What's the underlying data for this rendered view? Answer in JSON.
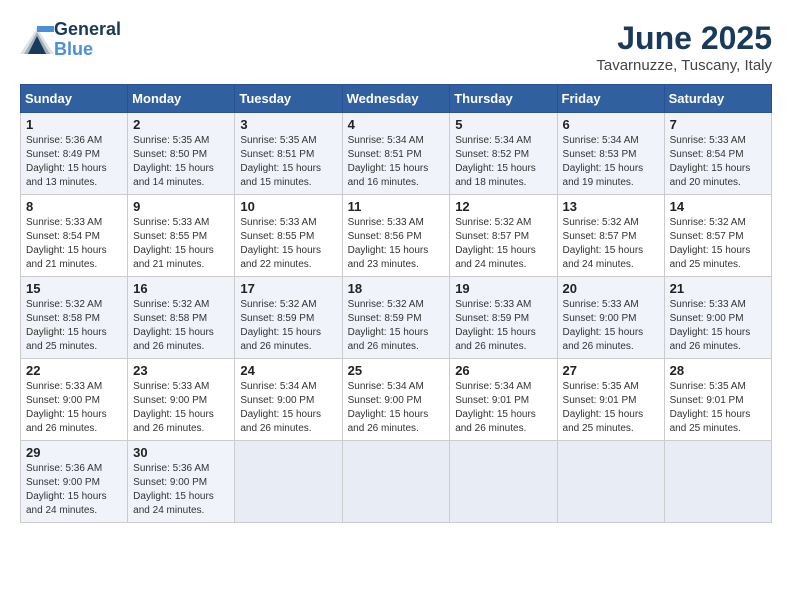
{
  "logo": {
    "line1": "General",
    "line2": "Blue"
  },
  "title": "June 2025",
  "location": "Tavarnuzze, Tuscany, Italy",
  "weekdays": [
    "Sunday",
    "Monday",
    "Tuesday",
    "Wednesday",
    "Thursday",
    "Friday",
    "Saturday"
  ],
  "weeks": [
    [
      {
        "day": 1,
        "sunrise": "5:36 AM",
        "sunset": "8:49 PM",
        "daylight": "15 hours and 13 minutes."
      },
      {
        "day": 2,
        "sunrise": "5:35 AM",
        "sunset": "8:50 PM",
        "daylight": "15 hours and 14 minutes."
      },
      {
        "day": 3,
        "sunrise": "5:35 AM",
        "sunset": "8:51 PM",
        "daylight": "15 hours and 15 minutes."
      },
      {
        "day": 4,
        "sunrise": "5:34 AM",
        "sunset": "8:51 PM",
        "daylight": "15 hours and 16 minutes."
      },
      {
        "day": 5,
        "sunrise": "5:34 AM",
        "sunset": "8:52 PM",
        "daylight": "15 hours and 18 minutes."
      },
      {
        "day": 6,
        "sunrise": "5:34 AM",
        "sunset": "8:53 PM",
        "daylight": "15 hours and 19 minutes."
      },
      {
        "day": 7,
        "sunrise": "5:33 AM",
        "sunset": "8:54 PM",
        "daylight": "15 hours and 20 minutes."
      }
    ],
    [
      {
        "day": 8,
        "sunrise": "5:33 AM",
        "sunset": "8:54 PM",
        "daylight": "15 hours and 21 minutes."
      },
      {
        "day": 9,
        "sunrise": "5:33 AM",
        "sunset": "8:55 PM",
        "daylight": "15 hours and 21 minutes."
      },
      {
        "day": 10,
        "sunrise": "5:33 AM",
        "sunset": "8:55 PM",
        "daylight": "15 hours and 22 minutes."
      },
      {
        "day": 11,
        "sunrise": "5:33 AM",
        "sunset": "8:56 PM",
        "daylight": "15 hours and 23 minutes."
      },
      {
        "day": 12,
        "sunrise": "5:32 AM",
        "sunset": "8:57 PM",
        "daylight": "15 hours and 24 minutes."
      },
      {
        "day": 13,
        "sunrise": "5:32 AM",
        "sunset": "8:57 PM",
        "daylight": "15 hours and 24 minutes."
      },
      {
        "day": 14,
        "sunrise": "5:32 AM",
        "sunset": "8:57 PM",
        "daylight": "15 hours and 25 minutes."
      }
    ],
    [
      {
        "day": 15,
        "sunrise": "5:32 AM",
        "sunset": "8:58 PM",
        "daylight": "15 hours and 25 minutes."
      },
      {
        "day": 16,
        "sunrise": "5:32 AM",
        "sunset": "8:58 PM",
        "daylight": "15 hours and 26 minutes."
      },
      {
        "day": 17,
        "sunrise": "5:32 AM",
        "sunset": "8:59 PM",
        "daylight": "15 hours and 26 minutes."
      },
      {
        "day": 18,
        "sunrise": "5:32 AM",
        "sunset": "8:59 PM",
        "daylight": "15 hours and 26 minutes."
      },
      {
        "day": 19,
        "sunrise": "5:33 AM",
        "sunset": "8:59 PM",
        "daylight": "15 hours and 26 minutes."
      },
      {
        "day": 20,
        "sunrise": "5:33 AM",
        "sunset": "9:00 PM",
        "daylight": "15 hours and 26 minutes."
      },
      {
        "day": 21,
        "sunrise": "5:33 AM",
        "sunset": "9:00 PM",
        "daylight": "15 hours and 26 minutes."
      }
    ],
    [
      {
        "day": 22,
        "sunrise": "5:33 AM",
        "sunset": "9:00 PM",
        "daylight": "15 hours and 26 minutes."
      },
      {
        "day": 23,
        "sunrise": "5:33 AM",
        "sunset": "9:00 PM",
        "daylight": "15 hours and 26 minutes."
      },
      {
        "day": 24,
        "sunrise": "5:34 AM",
        "sunset": "9:00 PM",
        "daylight": "15 hours and 26 minutes."
      },
      {
        "day": 25,
        "sunrise": "5:34 AM",
        "sunset": "9:00 PM",
        "daylight": "15 hours and 26 minutes."
      },
      {
        "day": 26,
        "sunrise": "5:34 AM",
        "sunset": "9:01 PM",
        "daylight": "15 hours and 26 minutes."
      },
      {
        "day": 27,
        "sunrise": "5:35 AM",
        "sunset": "9:01 PM",
        "daylight": "15 hours and 25 minutes."
      },
      {
        "day": 28,
        "sunrise": "5:35 AM",
        "sunset": "9:01 PM",
        "daylight": "15 hours and 25 minutes."
      }
    ],
    [
      {
        "day": 29,
        "sunrise": "5:36 AM",
        "sunset": "9:00 PM",
        "daylight": "15 hours and 24 minutes."
      },
      {
        "day": 30,
        "sunrise": "5:36 AM",
        "sunset": "9:00 PM",
        "daylight": "15 hours and 24 minutes."
      },
      null,
      null,
      null,
      null,
      null
    ]
  ]
}
